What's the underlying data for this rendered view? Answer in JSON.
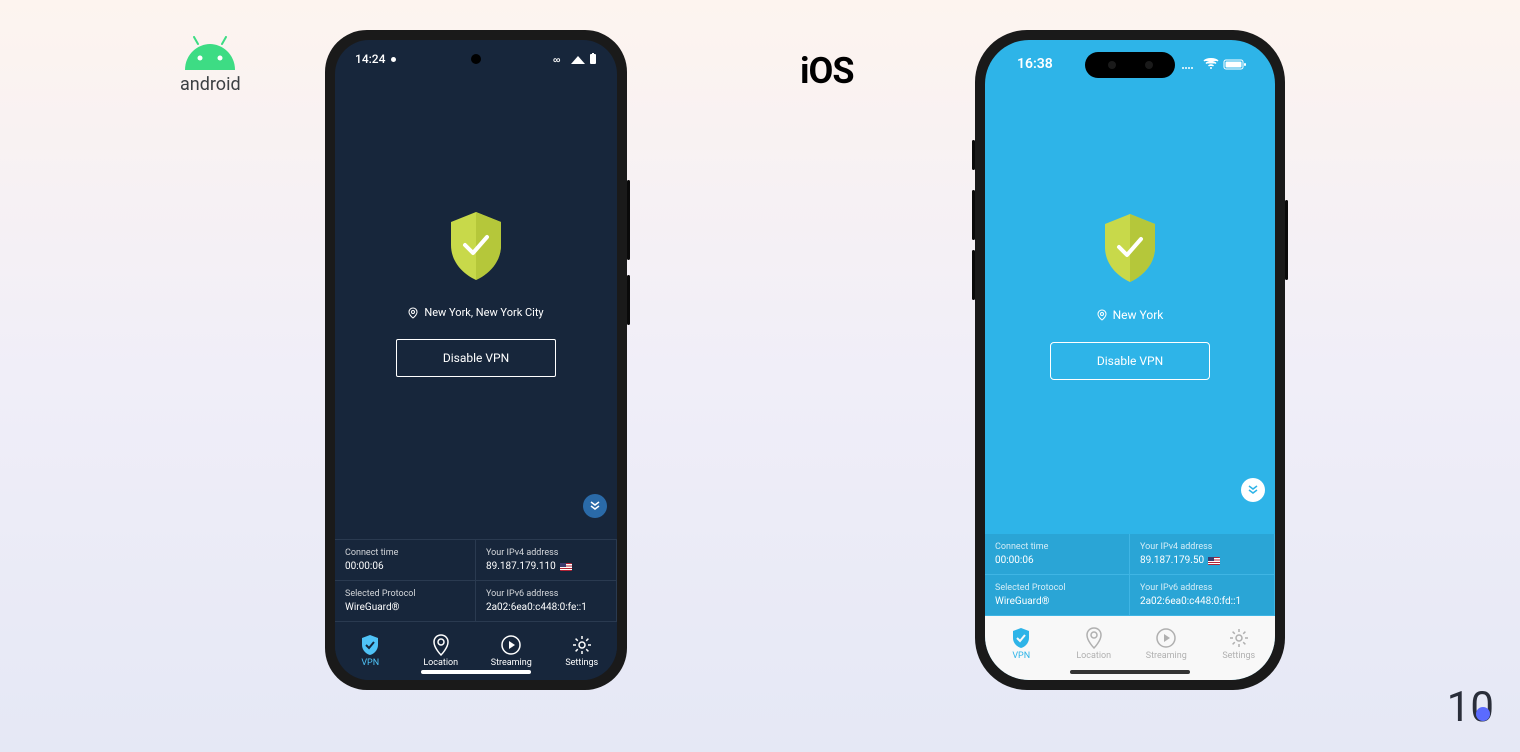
{
  "platforms": {
    "android_label": "android",
    "ios_label": "iOS"
  },
  "android": {
    "status": {
      "time": "14:24"
    },
    "location": "New York, New York City",
    "disable_btn": "Disable VPN",
    "info": {
      "connect_time": {
        "label": "Connect time",
        "value": "00:00:06"
      },
      "ipv4": {
        "label": "Your IPv4 address",
        "value": "89.187.179.110"
      },
      "protocol": {
        "label": "Selected Protocol",
        "value": "WireGuard®"
      },
      "ipv6": {
        "label": "Your IPv6 address",
        "value": "2a02:6ea0:c448:0:fe::1"
      }
    },
    "nav": {
      "vpn": "VPN",
      "location": "Location",
      "streaming": "Streaming",
      "settings": "Settings"
    }
  },
  "ios": {
    "status": {
      "time": "16:38"
    },
    "location": "New York",
    "disable_btn": "Disable VPN",
    "info": {
      "connect_time": {
        "label": "Connect time",
        "value": "00:00:06"
      },
      "ipv4": {
        "label": "Your IPv4 address",
        "value": "89.187.179.50"
      },
      "protocol": {
        "label": "Selected Protocol",
        "value": "WireGuard®"
      },
      "ipv6": {
        "label": "Your IPv6 address",
        "value": "2a02:6ea0:c448:0:fd::1"
      }
    },
    "nav": {
      "vpn": "VPN",
      "location": "Location",
      "streaming": "Streaming",
      "settings": "Settings"
    }
  },
  "brand": "10"
}
